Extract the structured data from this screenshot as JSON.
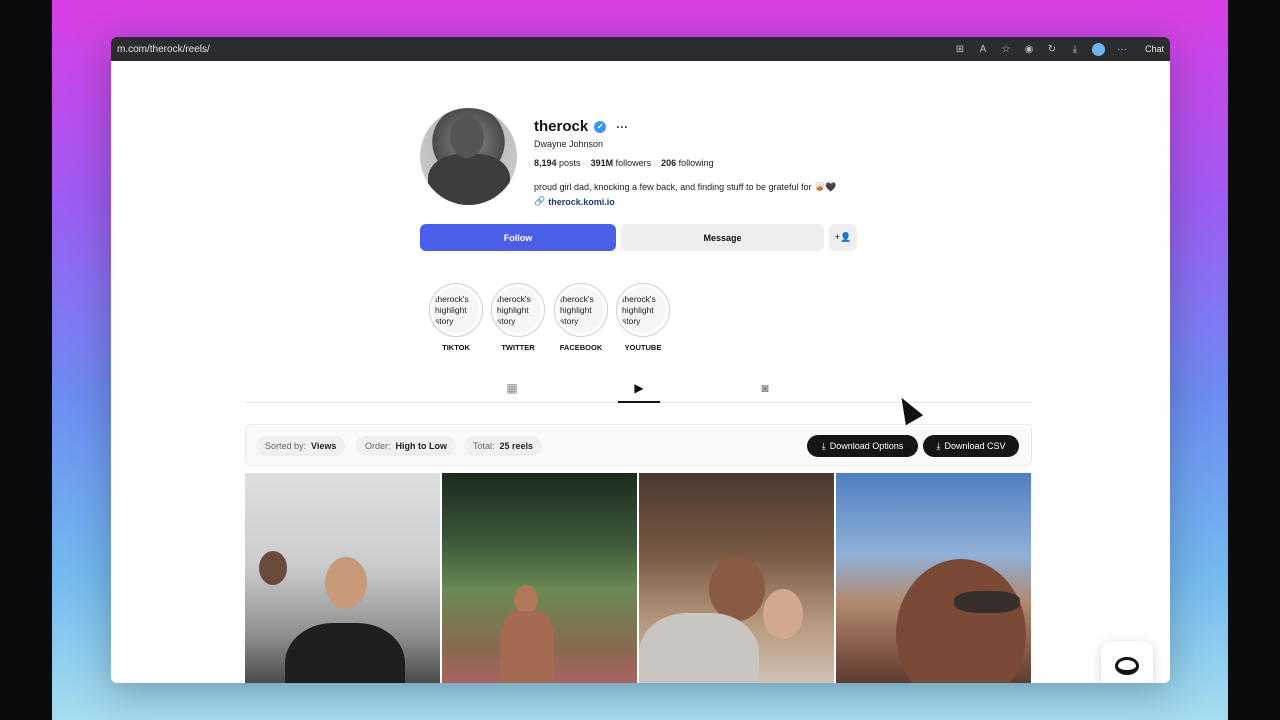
{
  "browser": {
    "url": "m.com/therock/reels/",
    "chat_label": "Chat"
  },
  "profile": {
    "username": "therock",
    "full_name": "Dwayne Johnson",
    "posts_count": "8,194",
    "posts_label": "posts",
    "followers_count": "391M",
    "followers_label": "followers",
    "following_count": "206",
    "following_label": "following",
    "bio": "proud girl dad, knocking a few back, and finding stuff to be grateful for 🥃🖤",
    "link": "therock.komi.io"
  },
  "actions": {
    "follow_label": "Follow",
    "message_label": "Message"
  },
  "highlights": [
    {
      "cover_text": "therock's highlight story",
      "label": "TIKTOK"
    },
    {
      "cover_text": "therock's highlight story",
      "label": "TWITTER"
    },
    {
      "cover_text": "therock's highlight story",
      "label": "FACEBOOK"
    },
    {
      "cover_text": "therock's highlight story",
      "label": "YOUTUBE"
    }
  ],
  "tabs": [
    "grid-icon",
    "reels-icon",
    "tagged-icon"
  ],
  "sortbar": {
    "sorted_label": "Sorted by:",
    "sorted_value": "Views",
    "order_label": "Order:",
    "order_value": "High to Low",
    "total_label": "Total:",
    "total_value": "25 reels",
    "download_options": "Download Options",
    "download_csv": "Download CSV"
  },
  "colors": {
    "follow_button": "#4a5ee8",
    "verified_badge": "#3897f0",
    "download_button": "#151515"
  }
}
